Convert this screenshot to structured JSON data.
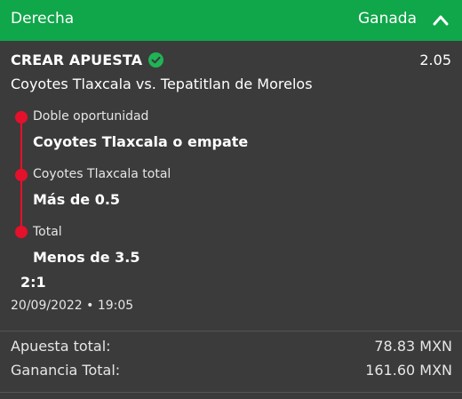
{
  "header": {
    "title": "Derecha",
    "status": "Ganada",
    "background": "#10a64a",
    "toggle_icon": "chevron-up-icon"
  },
  "bet": {
    "type": "CREAR APUESTA",
    "verified_icon": "check-circle-icon",
    "odds": "2.05",
    "match": "Coyotes Tlaxcala vs. Tepatitlan de Morelos",
    "accent": "#e5102b",
    "selections": [
      {
        "label": "Doble oportunidad",
        "value": "Coyotes Tlaxcala o empate"
      },
      {
        "label": "Coyotes Tlaxcala total",
        "value": "Más de 0.5"
      },
      {
        "label": "Total",
        "value": "Menos de 3.5"
      }
    ],
    "score": "2:1",
    "datetime": "20/09/2022 • 19:05"
  },
  "summary": {
    "stake_label": "Apuesta total:",
    "stake_value": "78.83 MXN",
    "win_label": "Ganancia Total:",
    "win_value": "161.60 MXN"
  }
}
